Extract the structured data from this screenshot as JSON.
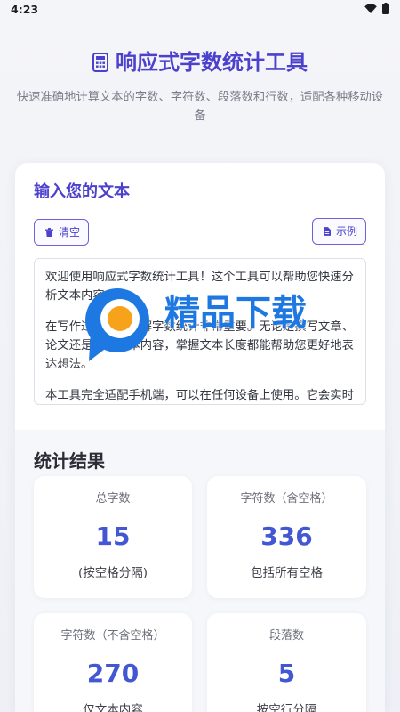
{
  "status_bar": {
    "time": "4:23",
    "wifi_icon": "wifi-icon",
    "battery_icon": "battery-icon"
  },
  "header": {
    "icon": "calculator-icon",
    "title": "响应式字数统计工具",
    "subtitle": "快速准确地计算文本的字数、字符数、段落数和行数，适配各种移动设备"
  },
  "input_section": {
    "heading": "输入您的文本",
    "clear_button": {
      "label": "清空",
      "icon": "trash-icon"
    },
    "example_button": {
      "label": "示例",
      "icon": "document-icon"
    },
    "text_paragraphs": [
      "欢迎使用响应式字数统计工具！这个工具可以帮助您快速分析文本内容。",
      "在写作过程中，了解字数统计非常重要。无论是撰写文章、论文还是其他文本内容，掌握文本长度都能帮助您更好地表达想法。",
      "本工具完全适配手机端，可以在任何设备上使用。它会实时"
    ]
  },
  "watermark": {
    "text": "精品下载"
  },
  "stats": {
    "heading": "统计结果",
    "cards": [
      {
        "label": "总字数",
        "value": 15,
        "note": "(按空格分隔)"
      },
      {
        "label": "字符数（含空格）",
        "value": 336,
        "note": "包括所有空格"
      },
      {
        "label": "字符数（不含空格）",
        "value": 270,
        "note": "仅文本内容"
      },
      {
        "label": "段落数",
        "value": 5,
        "note": "按空行分隔"
      }
    ]
  },
  "colors": {
    "accent": "#4c41cc",
    "stat_value": "#4357d3",
    "watermark": "#1e78e2"
  }
}
